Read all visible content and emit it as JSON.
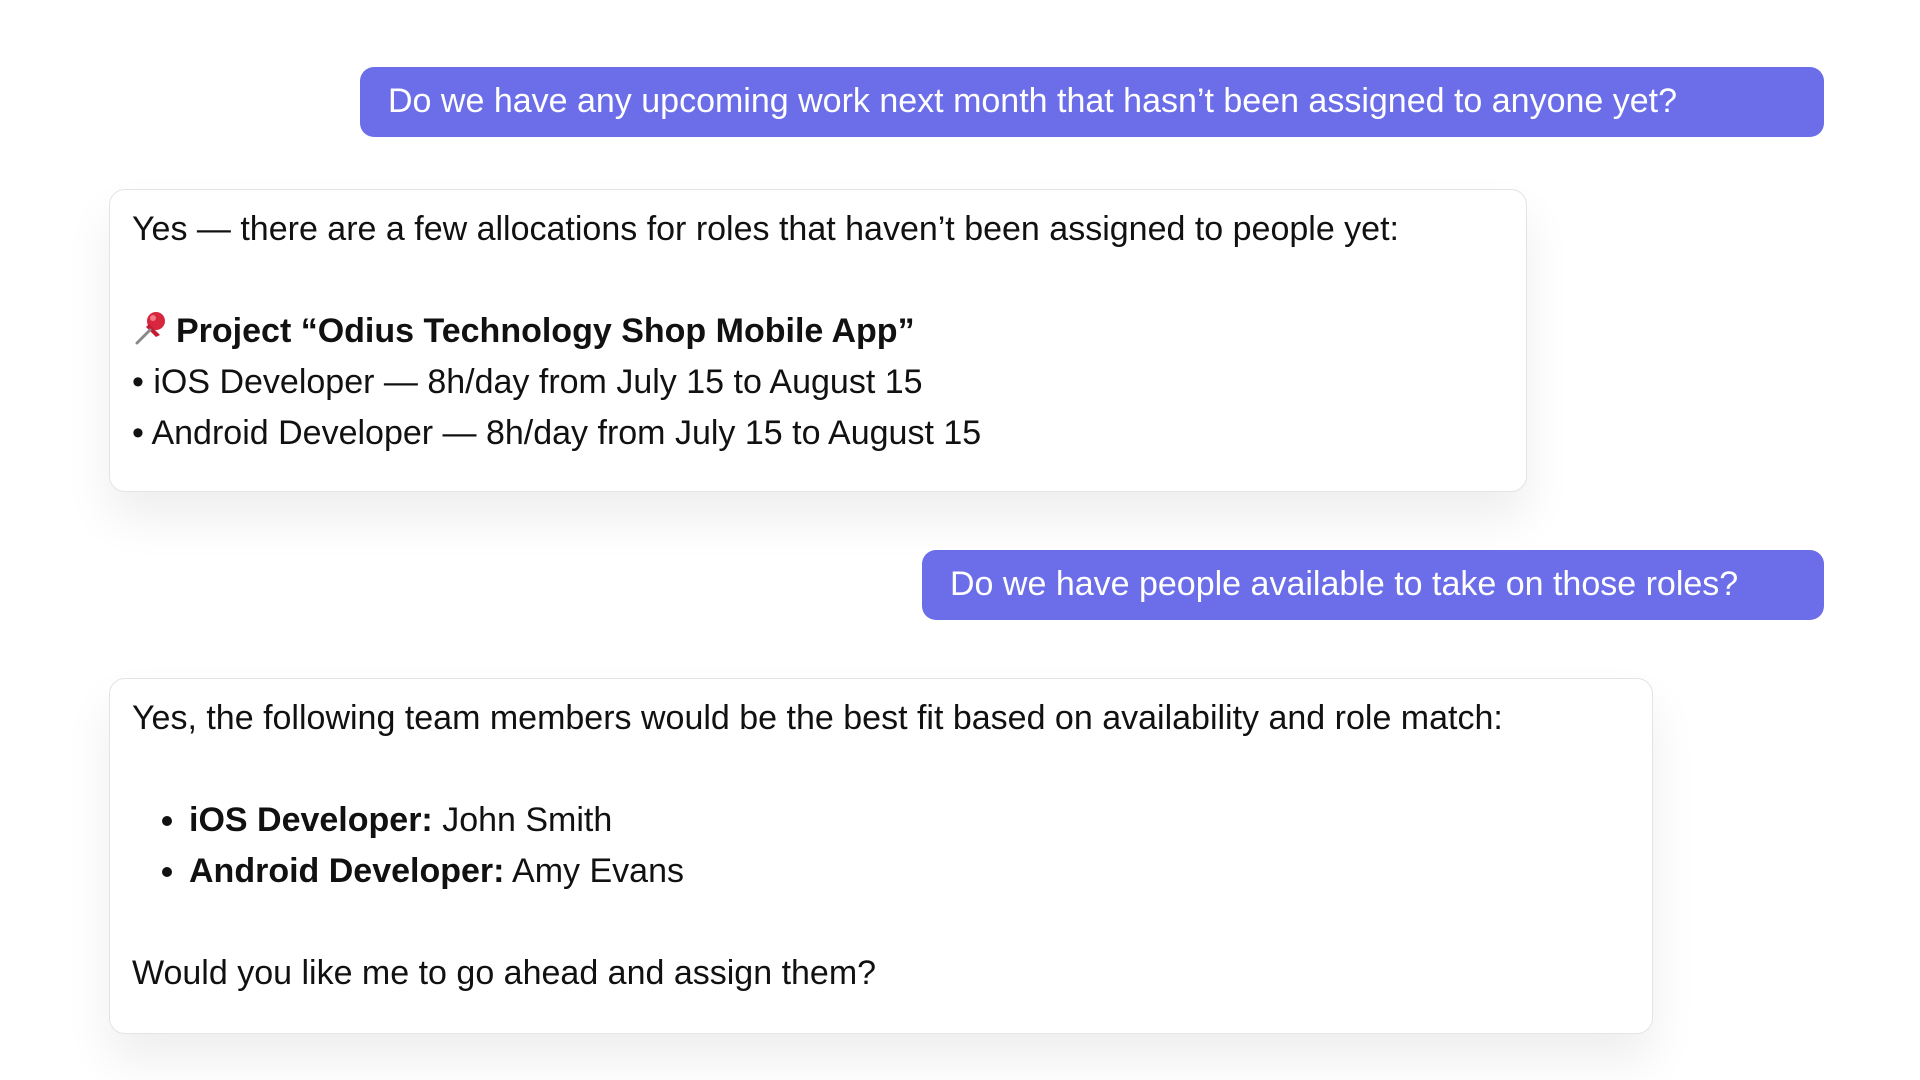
{
  "messages": {
    "user_1": "Do we have any upcoming work next month that hasn’t been assigned to anyone yet?",
    "assistant_1": {
      "intro": "Yes — there are a few allocations for roles that haven’t been assigned to people yet:",
      "project_icon": "pushpin-icon",
      "project_title": "Project “Odius Technology Shop Mobile App”",
      "roles": [
        "• iOS Developer — 8h/day from July 15 to August 15",
        "• Android Developer — 8h/day from July 15 to August 15"
      ]
    },
    "user_2": "Do we have people available to take on those roles?",
    "assistant_2": {
      "intro": "Yes, the following team members would be the best fit based on availability and role match:",
      "assignments": [
        {
          "role": "iOS Developer:",
          "person": " John Smith"
        },
        {
          "role": "Android Developer:",
          "person": " Amy Evans"
        }
      ],
      "question": "Would you like me to go ahead and assign them?"
    }
  },
  "colors": {
    "user_bubble": "#6b6ee8",
    "user_text": "#ffffff",
    "card_border": "#e4e4e8",
    "text": "#111111",
    "pin": "#d7263d"
  }
}
